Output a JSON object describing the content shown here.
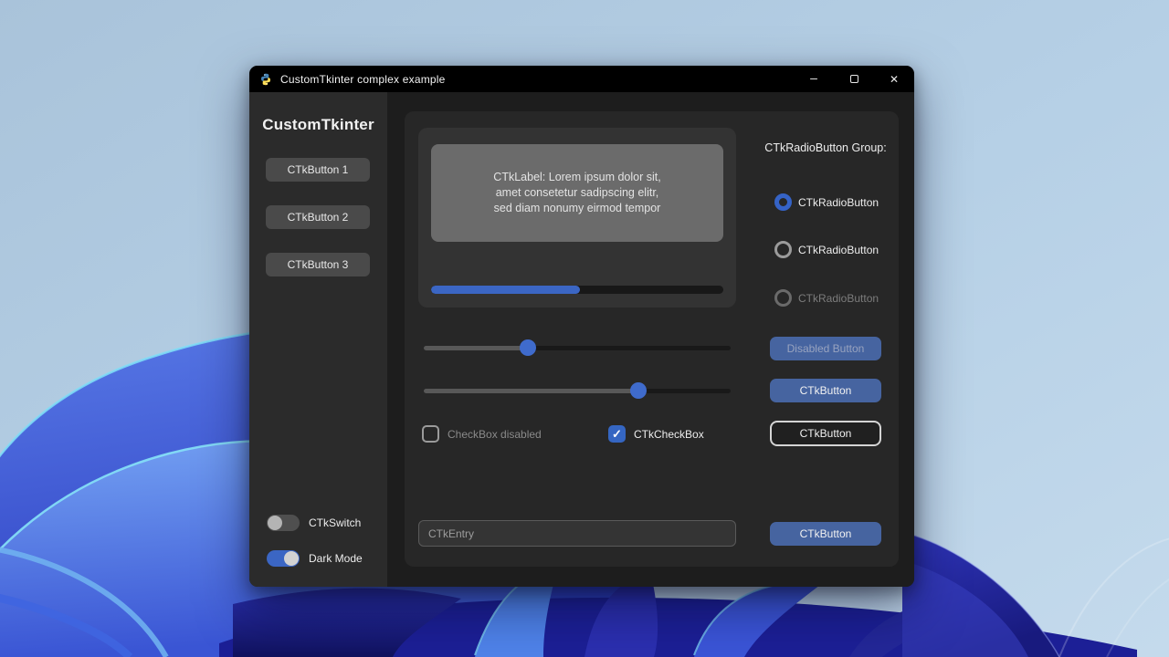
{
  "wallpaper": {
    "description": "Windows 11 bloom wallpaper",
    "sky_top": "#a9c3da",
    "sky_bottom": "#c4daec",
    "petal_blue": "#4f6fe2",
    "petal_bright": "#6e9cf2",
    "petal_dark": "#23279e",
    "rim_cyan": "#7fdef7"
  },
  "window": {
    "title": "CustomTkinter complex example",
    "controls": {
      "minimize": "–",
      "close": "✕"
    }
  },
  "sidebar": {
    "heading": "CustomTkinter",
    "buttons": [
      "CTkButton 1",
      "CTkButton 2",
      "CTkButton 3"
    ],
    "switches": [
      {
        "label": "CTkSwitch",
        "state": "off"
      },
      {
        "label": "Dark Mode",
        "state": "on"
      }
    ]
  },
  "main": {
    "label_lines": [
      "CTkLabel: Lorem ipsum dolor sit,",
      "amet consetetur sadipscing elitr,",
      "sed diam nonumy eirmod tempor"
    ],
    "progress": {
      "value_pct": 51
    },
    "sliders": [
      {
        "value_pct": 34
      },
      {
        "value_pct": 70
      }
    ],
    "checkboxes": [
      {
        "label": "CheckBox disabled",
        "checked": false,
        "disabled": true
      },
      {
        "label": "CTkCheckBox",
        "checked": true,
        "disabled": false
      }
    ],
    "check_glyph": "✓",
    "entry": {
      "placeholder": "CTkEntry",
      "value": ""
    },
    "radio_group": {
      "title": "CTkRadioButton Group:",
      "options": [
        {
          "label": "CTkRadioButton",
          "selected": true,
          "disabled": false
        },
        {
          "label": "CTkRadioButton",
          "selected": false,
          "disabled": false
        },
        {
          "label": "CTkRadioButton",
          "selected": false,
          "disabled": true
        }
      ]
    },
    "buttons": {
      "disabled": "Disabled Button",
      "primary": "CTkButton",
      "outline": "CTkButton",
      "entry_submit": "CTkButton"
    }
  },
  "colors": {
    "accent": "#3b66c4",
    "button_blue": "#4664a0",
    "titlebar": "#000000",
    "window_bg": "#1d1d1d",
    "sidebar_bg": "#2b2b2b",
    "frame_bg": "#272727",
    "subframe_bg": "#333333",
    "label_box_bg": "#6b6b6b"
  }
}
